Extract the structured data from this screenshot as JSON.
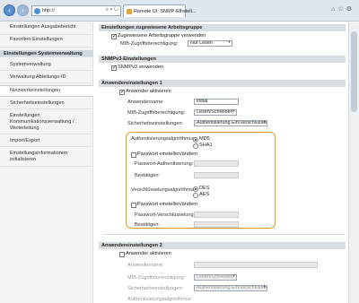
{
  "browser": {
    "url": "http://",
    "tab_title": "Remote UI: SNMP-Einstell...",
    "tab_close": "×"
  },
  "sidebar": {
    "items": [
      "Einstellungen Ausgabebericht",
      "Favoriten-Einstellungen",
      "Einstellungen Systemverwaltung",
      "Systemverwaltung",
      "Verwaltung Abteilungs-ID",
      "Netzwerkeinstellungen",
      "Sicherheitseinstellungen",
      "Einstellungen Kommunikationsverwaltung / Weiterleitung",
      "Import/Export",
      "Einstellungsinformationen initialisieren"
    ]
  },
  "main": {
    "workgroup_section": "Einstellungen zugewiesene Arbeitsgruppe",
    "workgroup_checkbox": "Zugewiesene Arbeitsgruppe verwenden",
    "mib_access_label": "MIB-Zugriffsberechtigung:",
    "mib_access_value": "Nur Lesen",
    "snmpv3_section": "SNMPv3-Einstellungen",
    "snmpv3_checkbox": "SNMPv3 verwenden",
    "user1_section": "Anwendereinstellungen 1",
    "user1_enable": "Anwender aktivieren",
    "username_label": "Anwendername:",
    "username_value": "initial",
    "mib_rights_label": "MIB-Zugriffsberechtigung:",
    "mib_rights_value": "Lesen/Schreiben",
    "security_label": "Sicherheitseinstellungen:",
    "security_value": "Authentisierung Ein/Verschlüsselung Ein",
    "auth_algo_label": "Authentisierungsalgorithmus:",
    "auth_md5": "MD5",
    "auth_sha1": "SHA1",
    "set_password_1": "Passwort einstellen/ändern",
    "auth_password_label": "Passwort-Authentisierung:",
    "confirm_label_1": "Bestätigen:",
    "enc_algo_label": "Verschlüsselungsalgorithmus:",
    "enc_des": "DES",
    "enc_aes": "AES",
    "set_password_2": "Passwort einstellen/ändern",
    "enc_password_label": "Passwort-Verschlüsselung:",
    "confirm_label_2": "Bestätigen:",
    "user2_section": "Anwendereinstellungen 2",
    "user2_enable": "Anwender aktivieren",
    "user2_username_label": "Anwendername:",
    "user2_mib_label": "MIB-Zugriffsberechtigung:",
    "user2_mib_value": "Lesen/Schreiben",
    "user2_security_label": "Sicherheitseinstellungen:",
    "user2_security_value": "Authentisierung Ein/Verschlüsselung Ein",
    "user2_auth_label": "Authentisierungsalgorithmus:"
  },
  "colors": {
    "highlight": "#e0a020",
    "section_bg": "#d9dee3"
  }
}
